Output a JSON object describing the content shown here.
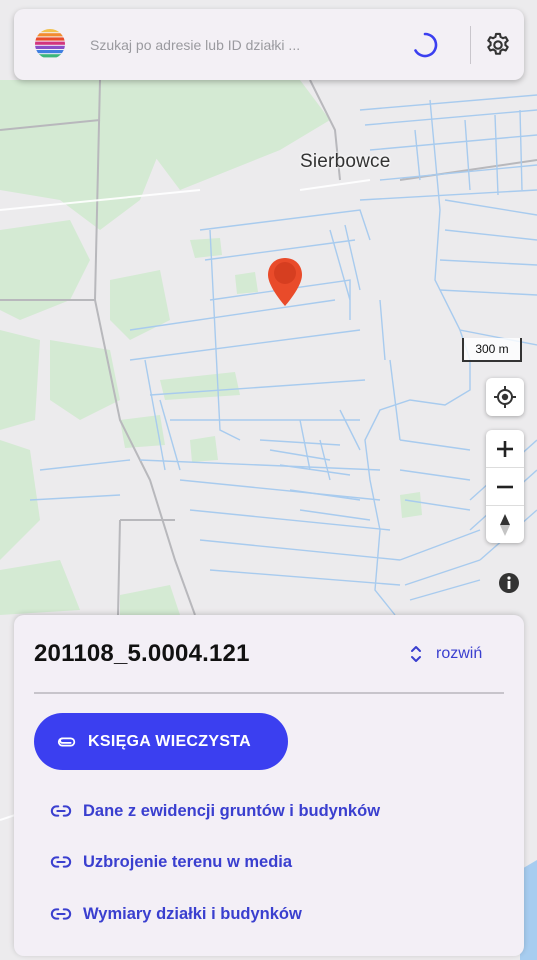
{
  "search": {
    "placeholder": "Szukaj po adresie lub ID działki ...",
    "value": "",
    "logo_icon": "rainbow-logo-icon",
    "status_icon": "loading-spinner-icon",
    "settings_icon": "gear-icon"
  },
  "map": {
    "town_label": "Sierbowce",
    "scale_label": "300 m",
    "marker_icon": "map-pin-icon",
    "colors": {
      "background": "#ecebed",
      "forest": "#d4ead3",
      "water": "#a7cdf0",
      "road": "#b9b9b9",
      "marker": "#e94b2a"
    },
    "controls": {
      "locate_icon": "crosshair-icon",
      "zoom_in_icon": "plus-icon",
      "zoom_out_icon": "minus-icon",
      "compass_icon": "compass-icon",
      "info_icon": "info-icon"
    }
  },
  "panel": {
    "parcel_id": "201108_5.0004.121",
    "expand_label": "rozwiń",
    "expand_icon": "chevron-up-down-icon",
    "primary_button": {
      "label": "KSIĘGA WIECZYSTA",
      "icon": "paperclip-icon"
    },
    "links": [
      {
        "label": "Dane z ewidencji gruntów i budynków",
        "icon": "link-icon"
      },
      {
        "label": "Uzbrojenie terenu w media",
        "icon": "link-icon"
      },
      {
        "label": "Wymiary działki i budynków",
        "icon": "link-icon"
      }
    ],
    "colors": {
      "accent": "#3b3ff0",
      "link": "#3a3fcf",
      "panel_bg": "#f3eff6"
    }
  }
}
